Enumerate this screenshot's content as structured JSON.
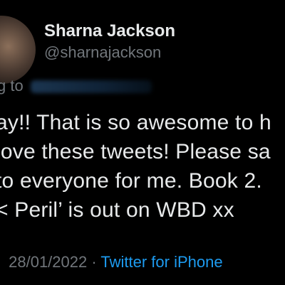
{
  "tweet": {
    "author_name": "Sharna Jackson",
    "author_handle": "@sharnajackson",
    "reply_prefix": "g to",
    "body_lines": [
      "ay!! That is so awesome to h",
      " love these tweets! Please sa",
      "to everyone for me. Book 2.",
      "< Peril’ is out on WBD xx"
    ],
    "date": "28/01/2022",
    "separator": "·",
    "source": "Twitter for iPhone"
  },
  "colors": {
    "background": "#000000",
    "primary_text": "#e7e9ea",
    "secondary_text": "#71767b",
    "link": "#1d9bf0"
  },
  "icons": {
    "avatar": "profile-photo"
  }
}
